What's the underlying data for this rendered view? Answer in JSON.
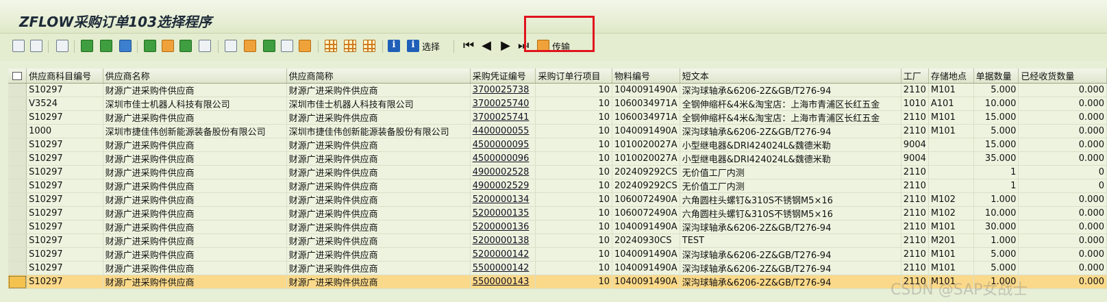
{
  "app": {
    "title": "ZFLOW采购订单103选择程序"
  },
  "toolbar": {
    "select_label": "选择",
    "transfer_label": "传输",
    "colors": {
      "accent_highlight": "#e0141e",
      "selected_row": "#fbd98a"
    }
  },
  "table": {
    "columns": [
      "供应商科目编号",
      "供应商名称",
      "供应商简称",
      "采购凭证编号",
      "采购订单行项目",
      "物料编号",
      "短文本",
      "工厂",
      "存储地点",
      "单据数量",
      "已经收货数量"
    ],
    "rows": [
      [
        "S10297",
        "财源广进采购件供应商",
        "财源广进采购件供应商",
        "3700025738",
        "10",
        "1040091490A",
        "深沟球轴承&6206-2Z&GB/T276-94",
        "2110",
        "M101",
        "5.000",
        "0.000"
      ],
      [
        "V3524",
        "深圳市佳士机器人科技有限公司",
        "深圳市佳士机器人科技有限公司",
        "3700025740",
        "10",
        "1060034971A",
        "全钢伸缩杆&4米&淘宝店：上海市青浦区长红五金",
        "1010",
        "A101",
        "10.000",
        "0.000"
      ],
      [
        "S10297",
        "财源广进采购件供应商",
        "财源广进采购件供应商",
        "3700025741",
        "10",
        "1060034971A",
        "全钢伸缩杆&4米&淘宝店：上海市青浦区长红五金",
        "2110",
        "M101",
        "15.000",
        "0.000"
      ],
      [
        "1000",
        "深圳市捷佳伟创新能源装备股份有限公司",
        "深圳市捷佳伟创新能源装备股份有限公司",
        "4400000055",
        "10",
        "1040091490A",
        "深沟球轴承&6206-2Z&GB/T276-94",
        "2110",
        "M101",
        "5.000",
        "0.000"
      ],
      [
        "S10297",
        "财源广进采购件供应商",
        "财源广进采购件供应商",
        "4500000095",
        "10",
        "1010020027A",
        "小型继电器&DRI424024L&魏德米勒",
        "9004",
        "",
        "15.000",
        "0.000"
      ],
      [
        "S10297",
        "财源广进采购件供应商",
        "财源广进采购件供应商",
        "4500000096",
        "10",
        "1010020027A",
        "小型继电器&DRI424024L&魏德米勒",
        "9004",
        "",
        "35.000",
        "0.000"
      ],
      [
        "S10297",
        "财源广进采购件供应商",
        "财源广进采购件供应商",
        "4900002528",
        "10",
        "202409292CS",
        "无价值工厂内测",
        "2110",
        "",
        "1",
        "0"
      ],
      [
        "S10297",
        "财源广进采购件供应商",
        "财源广进采购件供应商",
        "4900002529",
        "10",
        "202409292CS",
        "无价值工厂内测",
        "2110",
        "",
        "1",
        "0"
      ],
      [
        "S10297",
        "财源广进采购件供应商",
        "财源广进采购件供应商",
        "5200000134",
        "10",
        "1060072490A",
        "六角圆柱头螺钉&310S不锈钢M5×16",
        "2110",
        "M102",
        "1.000",
        "0.000"
      ],
      [
        "S10297",
        "财源广进采购件供应商",
        "财源广进采购件供应商",
        "5200000135",
        "10",
        "1060072490A",
        "六角圆柱头螺钉&310S不锈钢M5×16",
        "2110",
        "M102",
        "10.000",
        "0.000"
      ],
      [
        "S10297",
        "财源广进采购件供应商",
        "财源广进采购件供应商",
        "5200000136",
        "10",
        "1040091490A",
        "深沟球轴承&6206-2Z&GB/T276-94",
        "2110",
        "M101",
        "30.000",
        "0.000"
      ],
      [
        "S10297",
        "财源广进采购件供应商",
        "财源广进采购件供应商",
        "5200000138",
        "10",
        "20240930CS",
        "TEST",
        "2110",
        "M201",
        "1.000",
        "0.000"
      ],
      [
        "S10297",
        "财源广进采购件供应商",
        "财源广进采购件供应商",
        "5200000142",
        "10",
        "1040091490A",
        "深沟球轴承&6206-2Z&GB/T276-94",
        "2110",
        "M101",
        "5.000",
        "0.000"
      ],
      [
        "S10297",
        "财源广进采购件供应商",
        "财源广进采购件供应商",
        "5500000142",
        "10",
        "1040091490A",
        "深沟球轴承&6206-2Z&GB/T276-94",
        "2110",
        "M101",
        "5.000",
        "0.000"
      ],
      [
        "S10297",
        "财源广进采购件供应商",
        "财源广进采购件供应商",
        "5500000143",
        "10",
        "1040091490A",
        "深沟球轴承&6206-2Z&GB/T276-94",
        "2110",
        "M101",
        "1.000",
        "0.000"
      ]
    ],
    "selected_row_index": 14
  },
  "watermark": "CSDN @SAP女战士"
}
